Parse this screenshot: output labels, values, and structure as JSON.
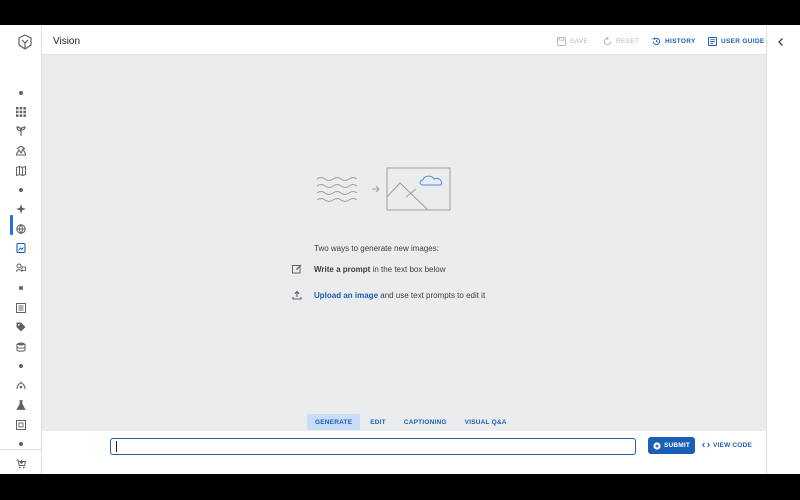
{
  "app": {
    "title": "Vision"
  },
  "header": {
    "save_label": "SAVE",
    "reset_label": "RESET",
    "history_label": "HISTORY",
    "user_guide_label": "USER GUIDE"
  },
  "sidebar": {
    "items": [
      {
        "icon": "dot"
      },
      {
        "icon": "grid-icon"
      },
      {
        "icon": "sprout-icon"
      },
      {
        "icon": "landscape-icon"
      },
      {
        "icon": "map-icon"
      },
      {
        "icon": "dot"
      },
      {
        "icon": "sparkle-icon"
      },
      {
        "icon": "globe-icon"
      },
      {
        "icon": "image-doc-icon",
        "active": true
      },
      {
        "icon": "people-image-icon"
      },
      {
        "icon": "dot"
      },
      {
        "icon": "list-box-icon"
      },
      {
        "icon": "tag-icon"
      },
      {
        "icon": "database-icon"
      },
      {
        "icon": "dot"
      },
      {
        "icon": "stream-icon"
      },
      {
        "icon": "flask-icon"
      },
      {
        "icon": "frame-icon"
      },
      {
        "icon": "dot"
      },
      {
        "icon": "cart-icon"
      }
    ]
  },
  "empty_state": {
    "heading": "Two ways to generate new images:",
    "option1_bold": "Write a prompt",
    "option1_rest": " in the text box below",
    "option2_link": "Upload an image",
    "option2_rest": " and use text prompts to edit it"
  },
  "tabs": [
    {
      "label": "GENERATE",
      "selected": true
    },
    {
      "label": "EDIT",
      "selected": false
    },
    {
      "label": "CAPTIONING",
      "selected": false
    },
    {
      "label": "VISUAL Q&A",
      "selected": false
    }
  ],
  "prompt": {
    "value": "",
    "placeholder": ""
  },
  "actions": {
    "submit_label": "SUBMIT",
    "view_code_label": "VIEW CODE"
  },
  "colors": {
    "accent": "#1a5fb4",
    "canvas_bg": "#ebecee",
    "tab_selected_bg": "#c9dcf8"
  }
}
